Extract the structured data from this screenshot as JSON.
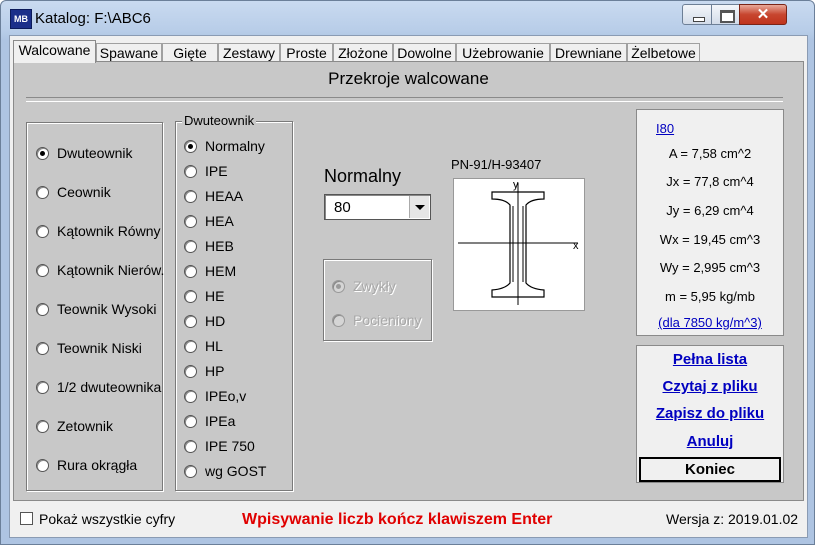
{
  "window": {
    "title": "Katalog: F:\\ABC6",
    "close_glyph": "✕"
  },
  "tabs": [
    "Walcowane",
    "Spawane",
    "Gięte",
    "Zestawy",
    "Proste",
    "Złożone",
    "Dowolne",
    "Użebrowanie",
    "Drewniane",
    "Żelbetowe"
  ],
  "active_tab": "Walcowane",
  "panel_title": "Przekroje walcowane",
  "section_types": [
    {
      "label": "Dwuteownik",
      "checked": true
    },
    {
      "label": "Ceownik",
      "checked": false
    },
    {
      "label": "Kątownik Równy",
      "checked": false
    },
    {
      "label": "Kątownik Nierów.",
      "checked": false
    },
    {
      "label": "Teownik Wysoki",
      "checked": false
    },
    {
      "label": "Teownik Niski",
      "checked": false
    },
    {
      "label": "1/2 dwuteownika",
      "checked": false
    },
    {
      "label": "Zetownik",
      "checked": false
    },
    {
      "label": "Rura okrągła",
      "checked": false
    }
  ],
  "dwuteownik_group": {
    "label": "Dwuteownik",
    "options": [
      {
        "label": "Normalny",
        "checked": true
      },
      {
        "label": "IPE",
        "checked": false
      },
      {
        "label": "HEAA",
        "checked": false
      },
      {
        "label": "HEA",
        "checked": false
      },
      {
        "label": "HEB",
        "checked": false
      },
      {
        "label": "HEM",
        "checked": false
      },
      {
        "label": "HE",
        "checked": false
      },
      {
        "label": "HD",
        "checked": false
      },
      {
        "label": "HL",
        "checked": false
      },
      {
        "label": "HP",
        "checked": false
      },
      {
        "label": "IPEo,v",
        "checked": false
      },
      {
        "label": "IPEa",
        "checked": false
      },
      {
        "label": "IPE 750",
        "checked": false
      },
      {
        "label": "wg GOST",
        "checked": false
      }
    ]
  },
  "profile": {
    "title": "Normalny",
    "size_value": "80"
  },
  "variant": [
    {
      "label": "Zwykły",
      "checked": true
    },
    {
      "label": "Pocieniony",
      "checked": false
    }
  ],
  "standard": "PN-91/H-93407",
  "diagram": {
    "y_label": "y",
    "x_label": "x"
  },
  "properties": {
    "name": "I80",
    "lines": [
      "A = 7,58 cm^2",
      "Jx = 77,8 cm^4",
      "Jy = 6,29 cm^4",
      "Wx = 19,45 cm^3",
      "Wy = 2,995 cm^3",
      "m = 5,95 kg/mb"
    ],
    "density_note": "(dla 7850 kg/m^3)"
  },
  "actions": {
    "full_list": "Pełna lista",
    "read_file": "Czytaj z pliku",
    "save_file": "Zapisz do pliku",
    "cancel": "Anuluj",
    "end": "Koniec"
  },
  "footer": {
    "show_all_digits": "Pokaż wszystkie cyfry",
    "hint": "Wpisywanie liczb kończ klawiszem Enter",
    "version": "Wersja z: 2019.01.02"
  },
  "colors": {
    "hint": "#e00000",
    "link": "#0000c0",
    "panel": "#c8c8c8"
  }
}
